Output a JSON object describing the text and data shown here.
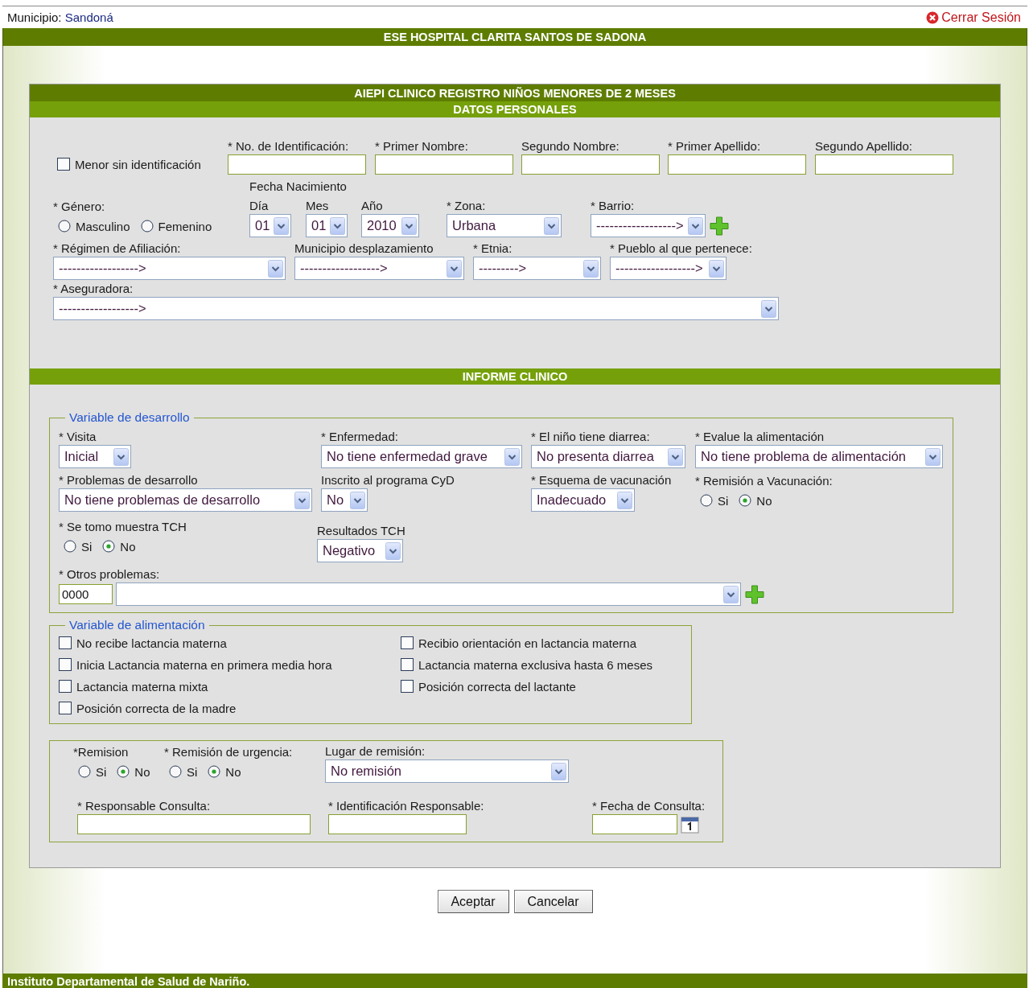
{
  "header": {
    "municipio_label": "Municipio:",
    "municipio": "Sandoná",
    "logout": "Cerrar Sesión"
  },
  "hospital": "ESE HOSPITAL CLARITA SANTOS DE SADONA",
  "form_title": "AIEPI CLINICO REGISTRO NIÑOS MENORES DE 2 MESES",
  "personal": {
    "heading": "DATOS PERSONALES",
    "rows": [
      [
        {
          "kind": "checkbox",
          "label": "Menor sin identificación",
          "checked": false
        },
        {
          "kind": "text",
          "label": "* No. de Identificación:"
        },
        {
          "kind": "text",
          "label": "* Primer Nombre:"
        },
        {
          "kind": "text",
          "label": "Segundo Nombre:"
        },
        {
          "kind": "text",
          "label": "* Primer Apellido:"
        },
        {
          "kind": "text",
          "label": "Segundo Apellido:"
        }
      ],
      [
        {
          "kind": "radio",
          "label": "* Género:",
          "options": [
            {
              "label": "Masculino",
              "selected": false
            },
            {
              "label": "Femenino",
              "selected": false
            }
          ]
        },
        {
          "kind": "date",
          "label": "Fecha Nacimiento",
          "parts": [
            {
              "label": "Día",
              "value": "01"
            },
            {
              "label": "Mes",
              "value": "01"
            },
            {
              "label": "Año",
              "value": "2010"
            }
          ]
        },
        {
          "kind": "select",
          "label": "* Zona:",
          "value": "Urbana"
        },
        {
          "kind": "select",
          "label": "* Barrio:",
          "value": "------------------>",
          "add_button": true
        }
      ],
      [
        {
          "kind": "select",
          "label": "* Régimen de Afiliación:",
          "value": "------------------>"
        },
        {
          "kind": "select",
          "label": "Municipio desplazamiento",
          "value": "------------------>"
        },
        {
          "kind": "select",
          "label": "* Etnia:",
          "value": "--------->"
        },
        {
          "kind": "select",
          "label": "* Pueblo al que pertenece:",
          "value": "------------------>"
        }
      ],
      [
        {
          "kind": "select",
          "label": "* Aseguradora:",
          "value": "------------------>"
        }
      ]
    ]
  },
  "clinical": {
    "heading": "INFORME CLINICO",
    "groups": [
      {
        "legend": "Variable de desarrollo",
        "rows": [
          [
            {
              "kind": "select",
              "label": "* Visita",
              "value": "Inicial"
            },
            {
              "kind": "select",
              "label": "* Enfermedad:",
              "value": "No tiene enfermedad grave"
            },
            {
              "kind": "select",
              "label": "* El niño tiene diarrea:",
              "value": "No presenta diarrea"
            },
            {
              "kind": "select",
              "label": "* Evalue la alimentación",
              "value": "No tiene problema de alimentación"
            }
          ],
          [
            {
              "kind": "select",
              "label": "* Problemas de desarrollo",
              "value": "No tiene problemas de desarrollo"
            },
            {
              "kind": "select",
              "label": "Inscrito al programa CyD",
              "value": "No"
            },
            {
              "kind": "select",
              "label": "* Esquema de vacunación",
              "value": "Inadecuado"
            },
            {
              "kind": "radio",
              "label": "* Remisión a Vacunación:",
              "options": [
                {
                  "label": "Si",
                  "selected": false
                },
                {
                  "label": "No",
                  "selected": true
                }
              ]
            }
          ],
          [
            {
              "kind": "radio",
              "label": "* Se tomo muestra TCH",
              "options": [
                {
                  "label": "Si",
                  "selected": false
                },
                {
                  "label": "No",
                  "selected": true
                }
              ]
            },
            {
              "kind": "select",
              "label": "Resultados TCH",
              "value": "Negativo"
            }
          ],
          [
            {
              "kind": "code_select",
              "label": "* Otros problemas:",
              "code": "0000",
              "add_button": true
            }
          ]
        ]
      },
      {
        "legend": "Variable de alimentación",
        "items": [
          {
            "label": "No recibe lactancia materna",
            "checked": false
          },
          {
            "label": "Recibio orientación en lactancia materna",
            "checked": false
          },
          {
            "label": "Inicia Lactancia materna en primera media hora",
            "checked": false
          },
          {
            "label": "Lactancia materna exclusiva hasta 6 meses",
            "checked": false
          },
          {
            "label": "Lactancia materna mixta",
            "checked": false
          },
          {
            "label": "Posición correcta del lactante",
            "checked": false
          },
          {
            "label": "Posición correcta de la madre",
            "checked": false
          }
        ]
      },
      {
        "fields": [
          {
            "kind": "radio",
            "label": "*Remision",
            "options": [
              {
                "label": "Si",
                "selected": false
              },
              {
                "label": "No",
                "selected": true
              }
            ]
          },
          {
            "kind": "radio",
            "label": "* Remisión de urgencia:",
            "options": [
              {
                "label": "Si",
                "selected": false
              },
              {
                "label": "No",
                "selected": true
              }
            ]
          },
          {
            "kind": "select",
            "label": "Lugar de remisión:",
            "value": "No remisión"
          },
          {
            "kind": "text",
            "label": "* Responsable Consulta:"
          },
          {
            "kind": "text",
            "label": "* Identificación Responsable:"
          },
          {
            "kind": "text",
            "label": "* Fecha de Consulta:",
            "calendar": true
          }
        ]
      }
    ]
  },
  "buttons": [
    "Aceptar",
    "Cancelar"
  ],
  "footer": "Instituto Departamental de Salud de Nariño."
}
